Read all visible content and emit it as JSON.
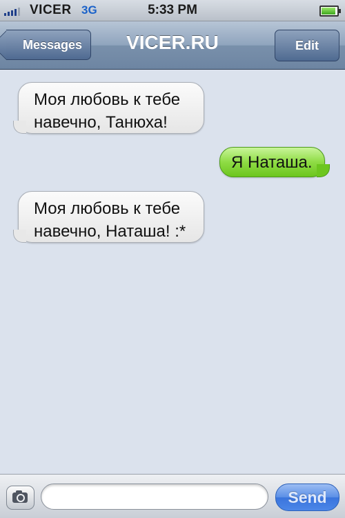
{
  "status_bar": {
    "carrier": "VICER",
    "network": "3G",
    "time": "5:33 PM",
    "battery_level": 0.85
  },
  "nav": {
    "back_label": "Messages",
    "title": "VICER.RU",
    "edit_label": "Edit"
  },
  "messages": [
    {
      "direction": "incoming",
      "text": "Моя любовь к тебе\nнавечно, Танюха!"
    },
    {
      "direction": "outgoing",
      "text": "Я Наташа."
    },
    {
      "direction": "incoming",
      "text": "Моя любовь к тебе\nнавечно, Наташа! :*"
    }
  ],
  "composer": {
    "input_value": "",
    "send_label": "Send",
    "camera_icon": "camera-icon"
  },
  "colors": {
    "incoming_bubble": "#f2f2f2",
    "outgoing_bubble": "#8fdc45",
    "nav_bar": "#8fa4bd",
    "send_button": "#4b86e8",
    "background": "#dbe2ed"
  }
}
